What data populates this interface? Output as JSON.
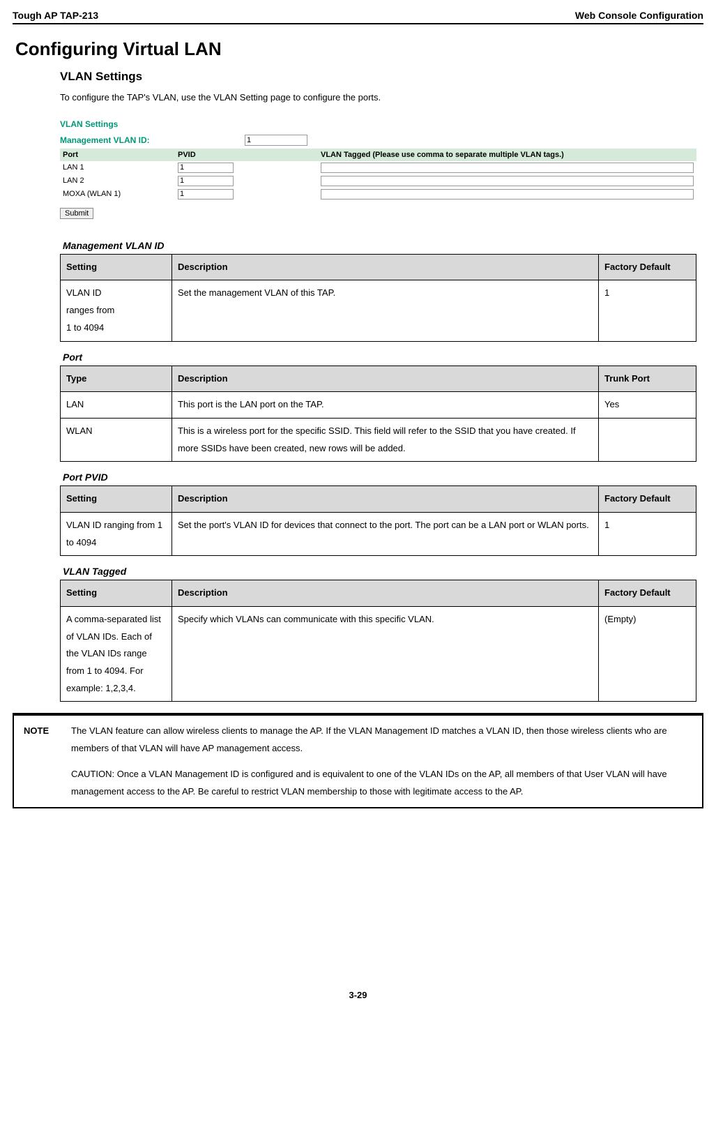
{
  "header": {
    "left": "Tough AP TAP-213",
    "right": "Web Console Configuration"
  },
  "h1": "Configuring Virtual LAN",
  "h2": "VLAN Settings",
  "intro": "To configure the TAP's VLAN, use the VLAN Setting page to configure the ports.",
  "screenshot": {
    "title": "VLAN Settings",
    "mgmt_label": "Management VLAN ID:",
    "mgmt_value": "1",
    "hdr": {
      "port": "Port",
      "pvid": "PVID",
      "tagged": "VLAN Tagged (Please use comma to separate multiple VLAN tags.)"
    },
    "rows": [
      {
        "port": "LAN 1",
        "pvid": "1",
        "tagged": ""
      },
      {
        "port": "LAN 2",
        "pvid": "1",
        "tagged": ""
      },
      {
        "port": "MOXA (WLAN 1)",
        "pvid": "1",
        "tagged": ""
      }
    ],
    "submit": "Submit"
  },
  "sections": [
    {
      "title": "Management VLAN ID",
      "headers": [
        "Setting",
        "Description",
        "Factory Default"
      ],
      "rows": [
        {
          "a": "VLAN ID\nranges from\n1 to 4094",
          "b": "Set the management VLAN of this TAP.",
          "c": "1"
        }
      ]
    },
    {
      "title": "Port",
      "headers": [
        "Type",
        "Description",
        "Trunk Port"
      ],
      "rows": [
        {
          "a": "LAN",
          "b": "This port is the LAN port on the TAP.",
          "c": "Yes"
        },
        {
          "a": "WLAN",
          "b": "This is a wireless port for the specific SSID. This field will refer to the SSID that you have created. If more SSIDs have been created, new rows will be added.",
          "c": ""
        }
      ]
    },
    {
      "title": "Port PVID",
      "headers": [
        "Setting",
        "Description",
        "Factory Default"
      ],
      "rows": [
        {
          "a": "VLAN ID ranging from 1 to 4094",
          "b": "Set the port's VLAN ID for devices that connect to the port. The port can be a LAN port or WLAN ports.",
          "c": "1"
        }
      ]
    },
    {
      "title": "VLAN Tagged",
      "headers": [
        "Setting",
        "Description",
        "Factory Default"
      ],
      "rows": [
        {
          "a": "A comma-separated list of VLAN IDs. Each of the VLAN IDs range from 1 to 4094. For example: 1,2,3,4.",
          "b": "Specify which VLANs can communicate with this specific VLAN.",
          "c": "(Empty)"
        }
      ]
    }
  ],
  "note": {
    "label": "NOTE",
    "p1": "The VLAN feature can allow wireless clients to manage the AP. If the VLAN Management ID matches a VLAN ID, then those wireless clients who are members of that VLAN will have AP management access.",
    "p2": "CAUTION: Once a VLAN Management ID is configured and is equivalent to one of the VLAN IDs on the AP, all members of that User VLAN will have management access to the AP. Be careful to restrict VLAN membership to those with legitimate access to the AP."
  },
  "page_number": "3-29"
}
